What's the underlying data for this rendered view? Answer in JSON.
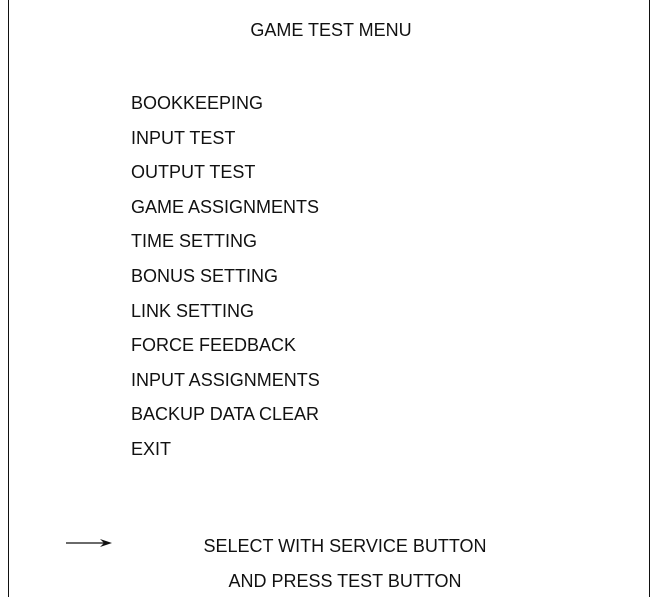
{
  "screen": {
    "title": "GAME TEST MENU",
    "menu_items": [
      "BOOKKEEPING",
      "INPUT TEST",
      "OUTPUT TEST",
      "GAME ASSIGNMENTS",
      "TIME SETTING",
      "BONUS SETTING",
      "LINK SETTING",
      "FORCE FEEDBACK",
      "INPUT ASSIGNMENTS",
      "BACKUP DATA CLEAR",
      "EXIT"
    ],
    "instruction_line1": "SELECT WITH SERVICE BUTTON",
    "instruction_line2": "AND PRESS TEST BUTTON",
    "pointer_icon": "right-arrow-icon"
  }
}
